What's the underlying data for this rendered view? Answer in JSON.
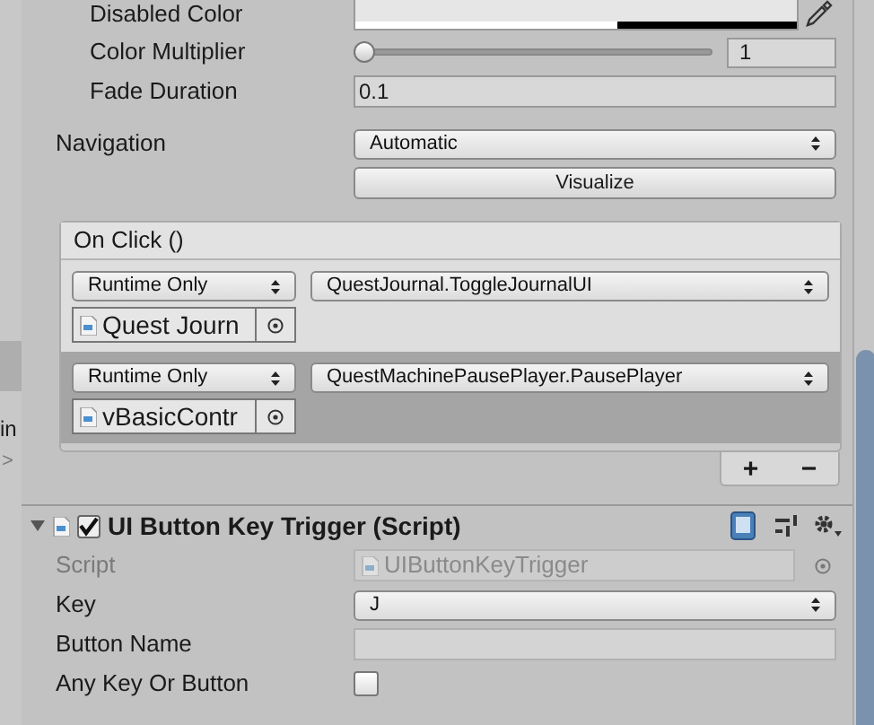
{
  "side_fragments": [
    "in",
    ">"
  ],
  "color_field": {
    "label": "Disabled Color"
  },
  "color_multiplier": {
    "label": "Color Multiplier",
    "level": 0,
    "value": "1"
  },
  "fade_duration": {
    "label": "Fade Duration",
    "value": "0.1"
  },
  "navigation": {
    "label": "Navigation",
    "value": "Automatic"
  },
  "visualize_button": "Visualize",
  "on_click": {
    "title": "On Click ()",
    "events": [
      {
        "mode": "Runtime Only",
        "function": "QuestJournal.ToggleJournalUI",
        "target": "Quest Journ",
        "selected": false
      },
      {
        "mode": "Runtime Only",
        "function": "QuestMachinePausePlayer.PausePlayer",
        "target": "vBasicContr",
        "selected": true
      }
    ],
    "add": "+",
    "remove": "−"
  },
  "component": {
    "title": "UI Button Key Trigger (Script)",
    "expanded": true,
    "enabled": true,
    "fields": [
      {
        "kind": "object",
        "label": "Script",
        "value": "UIButtonKeyTrigger",
        "disabled": true
      },
      {
        "kind": "dropdown",
        "label": "Key",
        "value": "J",
        "disabled": false
      },
      {
        "kind": "text",
        "label": "Button Name",
        "disabled": false
      },
      {
        "kind": "checkbox",
        "label": "Any Key Or Button",
        "checked": false,
        "disabled": false
      }
    ]
  }
}
